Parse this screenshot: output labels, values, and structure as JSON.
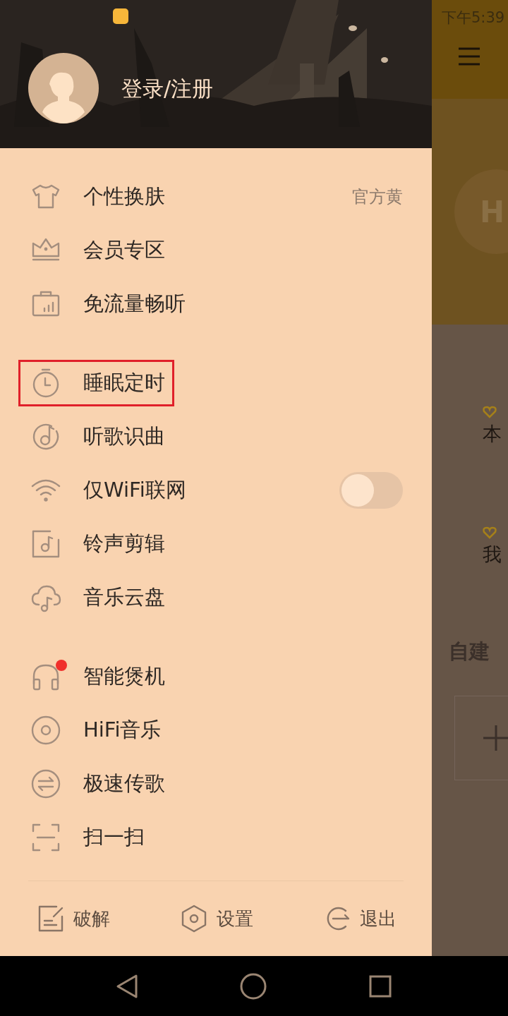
{
  "status_bar": {
    "time": "下午5:39"
  },
  "drawer": {
    "login": "登录/注册",
    "groups": [
      {
        "items": [
          {
            "label": "个性换肤",
            "kind": "value",
            "value": "官方黄",
            "dot": false,
            "highlighted": false
          },
          {
            "label": "会员专区",
            "kind": "link",
            "dot": false,
            "highlighted": false
          },
          {
            "label": "免流量畅听",
            "kind": "link",
            "dot": false,
            "highlighted": false
          }
        ]
      },
      {
        "items": [
          {
            "label": "睡眠定时",
            "kind": "link",
            "dot": false,
            "highlighted": true
          },
          {
            "label": "听歌识曲",
            "kind": "link",
            "dot": false,
            "highlighted": false
          },
          {
            "label": "仅WiFi联网",
            "kind": "toggle",
            "on": false,
            "dot": false,
            "highlighted": false
          },
          {
            "label": "铃声剪辑",
            "kind": "link",
            "dot": false,
            "highlighted": false
          },
          {
            "label": "音乐云盘",
            "kind": "link",
            "dot": false,
            "highlighted": false
          }
        ]
      },
      {
        "items": [
          {
            "label": "智能煲机",
            "kind": "link",
            "dot": true,
            "highlighted": false
          },
          {
            "label": "HiFi音乐",
            "kind": "link",
            "dot": false,
            "highlighted": false
          },
          {
            "label": "极速传歌",
            "kind": "link",
            "dot": false,
            "highlighted": false
          },
          {
            "label": "扫一扫",
            "kind": "link",
            "dot": false,
            "highlighted": false
          }
        ]
      }
    ],
    "footer": [
      {
        "label": "破解"
      },
      {
        "label": "设置"
      },
      {
        "label": "退出"
      }
    ]
  },
  "background_app": {
    "avatar_letter": "H",
    "entries": [
      {
        "label": "本"
      },
      {
        "label": "我"
      }
    ],
    "section_title": "自建"
  }
}
